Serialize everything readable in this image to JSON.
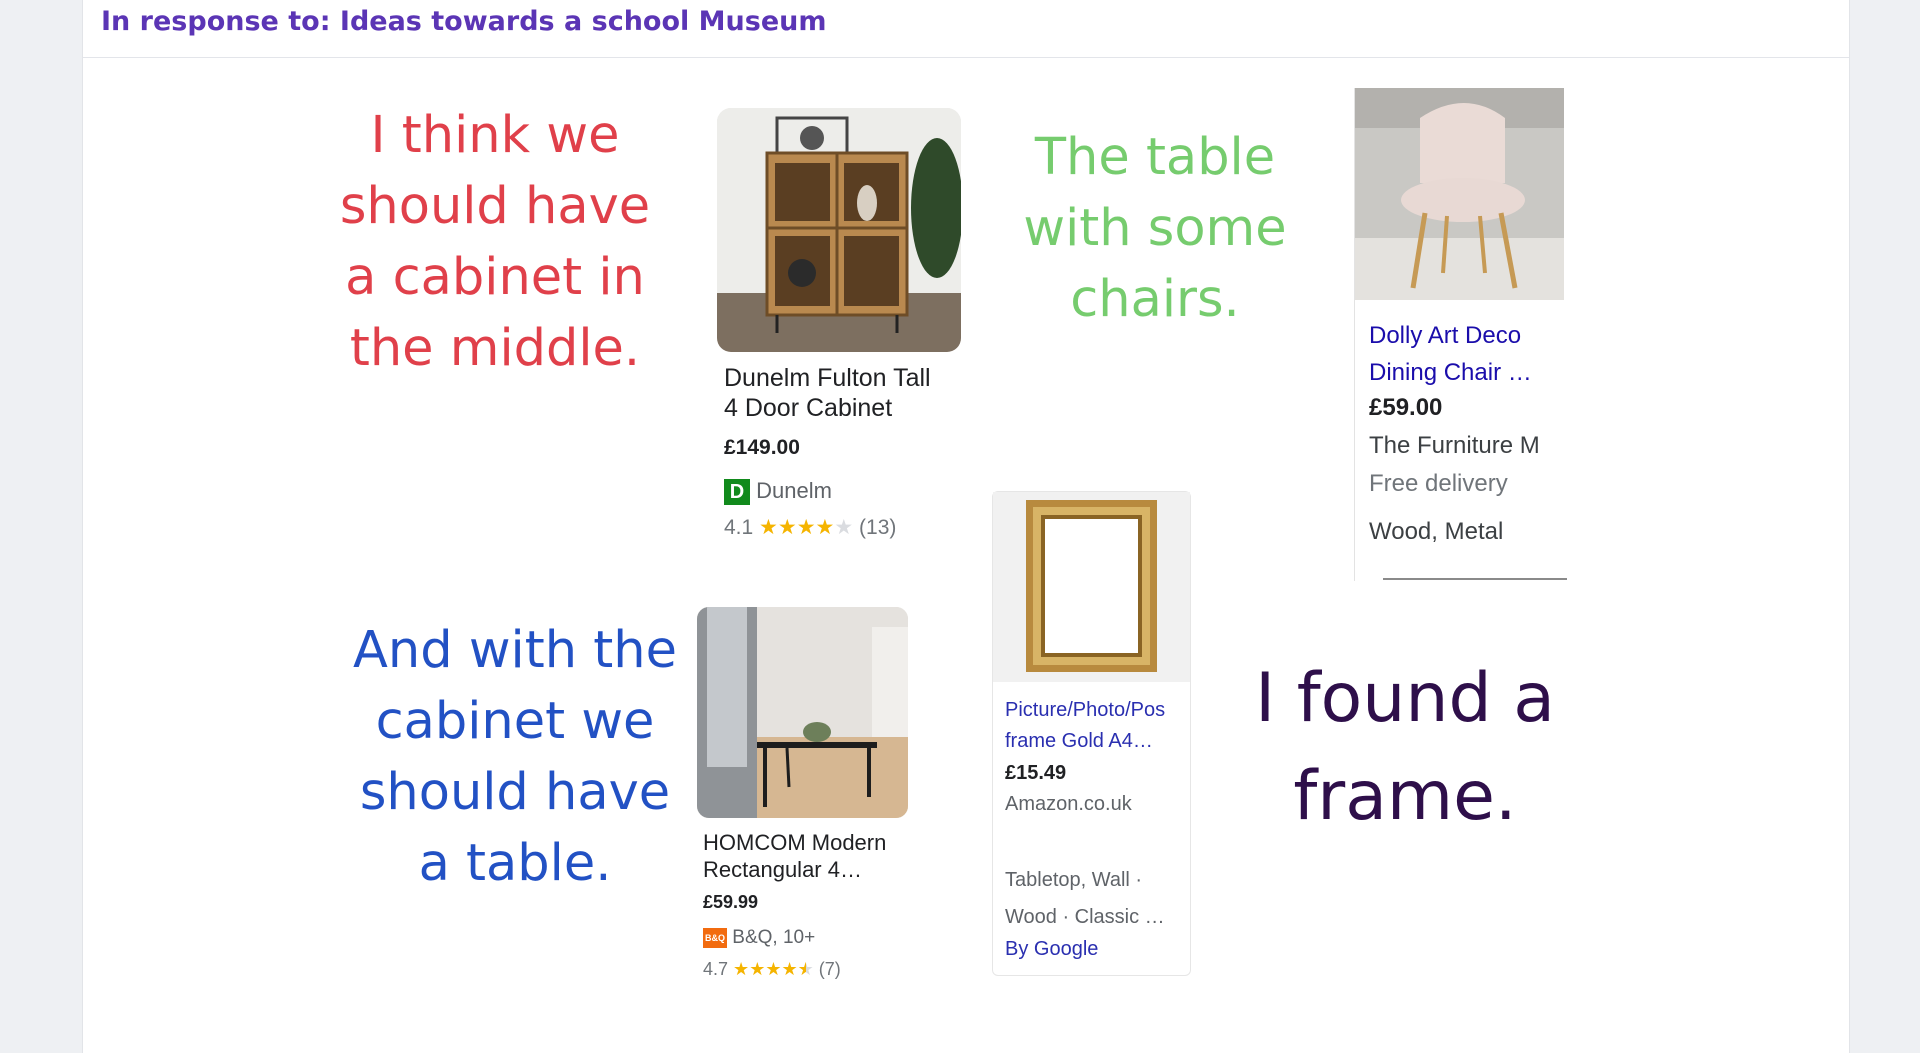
{
  "header": {
    "title": "In response to: Ideas towards a school Museum"
  },
  "notes": {
    "cabinet": {
      "lines": [
        "I think we",
        "should have",
        "a cabinet in",
        "the middle."
      ],
      "color": "#e0404a"
    },
    "chairs": {
      "lines": [
        "The table",
        "with some",
        "chairs."
      ],
      "color": "#76cc6e"
    },
    "table": {
      "lines": [
        "And with the",
        "cabinet we",
        "should have",
        "a table."
      ],
      "color": "#2251c4"
    },
    "frame": {
      "lines": [
        "I found a",
        "frame."
      ],
      "color": "#2e0f4a"
    }
  },
  "products": {
    "cabinet": {
      "title_lines": [
        "Dunelm Fulton Tall",
        "4 Door Cabinet"
      ],
      "price": "£149.00",
      "store_logo": "D",
      "store": "Dunelm",
      "rating": "4.1",
      "stars": 4,
      "reviews": "(13)"
    },
    "chair": {
      "title_lines": [
        "Dolly Art Deco",
        "Dining Chair …"
      ],
      "price": "£59.00",
      "store": "The Furniture M",
      "delivery": "Free delivery",
      "material": "Wood, Metal"
    },
    "table": {
      "title_lines": [
        "HOMCOM Modern",
        "Rectangular 4…"
      ],
      "price": "£59.99",
      "store_logo": "B&Q",
      "store": "B&Q, 10+",
      "rating": "4.7",
      "stars": 4.5,
      "reviews": "(7)"
    },
    "frame": {
      "title_lines": [
        "Picture/Photo/Pos",
        "frame Gold A4…"
      ],
      "price": "£15.49",
      "store": "Amazon.co.uk",
      "details": [
        "Tabletop, Wall ·",
        "Wood · Classic …"
      ],
      "by": "By Google"
    }
  },
  "colors": {
    "header": "#5b35b5",
    "link": "#1a0dab",
    "link2": "#2a2fb0",
    "dunelm": "#118a1c",
    "bq": "#f26b0f",
    "star": "#f5b400"
  },
  "icons": [
    "star-icon",
    "store-logo-icon"
  ]
}
